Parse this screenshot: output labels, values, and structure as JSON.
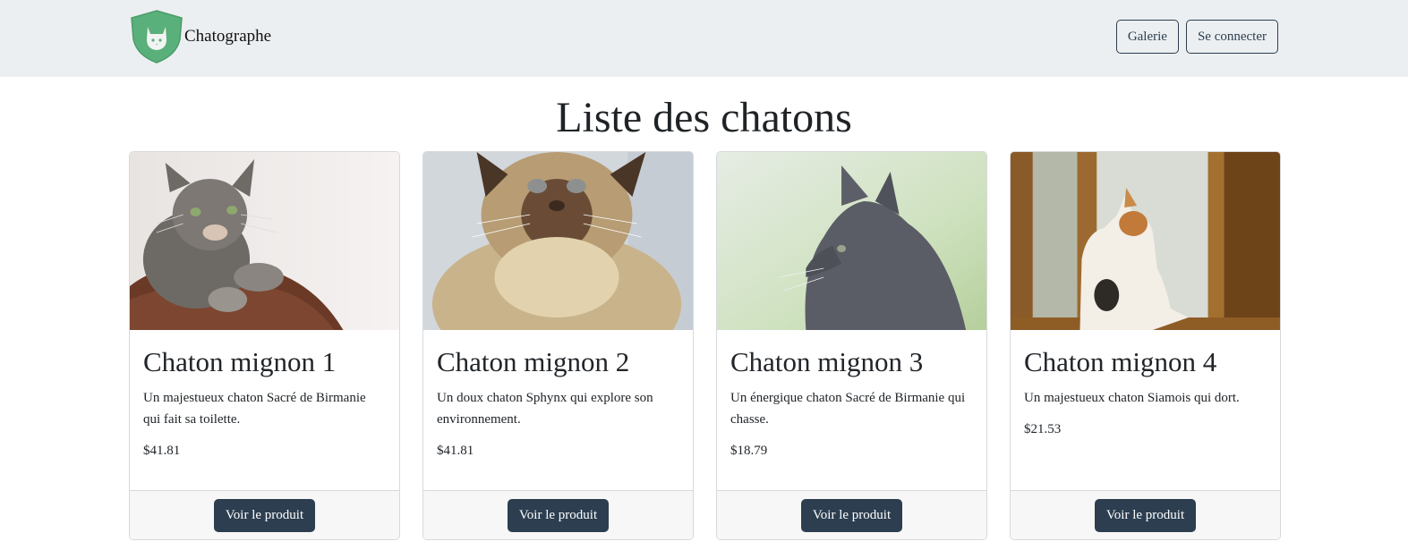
{
  "navbar": {
    "brand": "Chatographe",
    "logo_icon": "cat-shield-icon",
    "buttons": [
      {
        "label": "Galerie"
      },
      {
        "label": "Se connecter"
      }
    ]
  },
  "page_title": "Liste des chatons",
  "products": [
    {
      "title": "Chaton mignon 1",
      "description": "Un majestueux chaton Sacré de Birmanie qui fait sa toilette.",
      "price": "$41.81",
      "button": "Voir le produit",
      "image": "tabby-cat-photo"
    },
    {
      "title": "Chaton mignon 2",
      "description": "Un doux chaton Sphynx qui explore son environnement.",
      "price": "$41.81",
      "button": "Voir le produit",
      "image": "cream-cat-photo"
    },
    {
      "title": "Chaton mignon 3",
      "description": "Un énergique chaton Sacré de Birmanie qui chasse.",
      "price": "$18.79",
      "button": "Voir le produit",
      "image": "grey-cat-photo"
    },
    {
      "title": "Chaton mignon 4",
      "description": "Un majestueux chaton Siamois qui dort.",
      "price": "$21.53",
      "button": "Voir le produit",
      "image": "kitten-window-photo"
    }
  ],
  "colors": {
    "navbar_bg": "#eceff1",
    "primary": "#2c3e50",
    "logo_green": "#5ab07a"
  }
}
